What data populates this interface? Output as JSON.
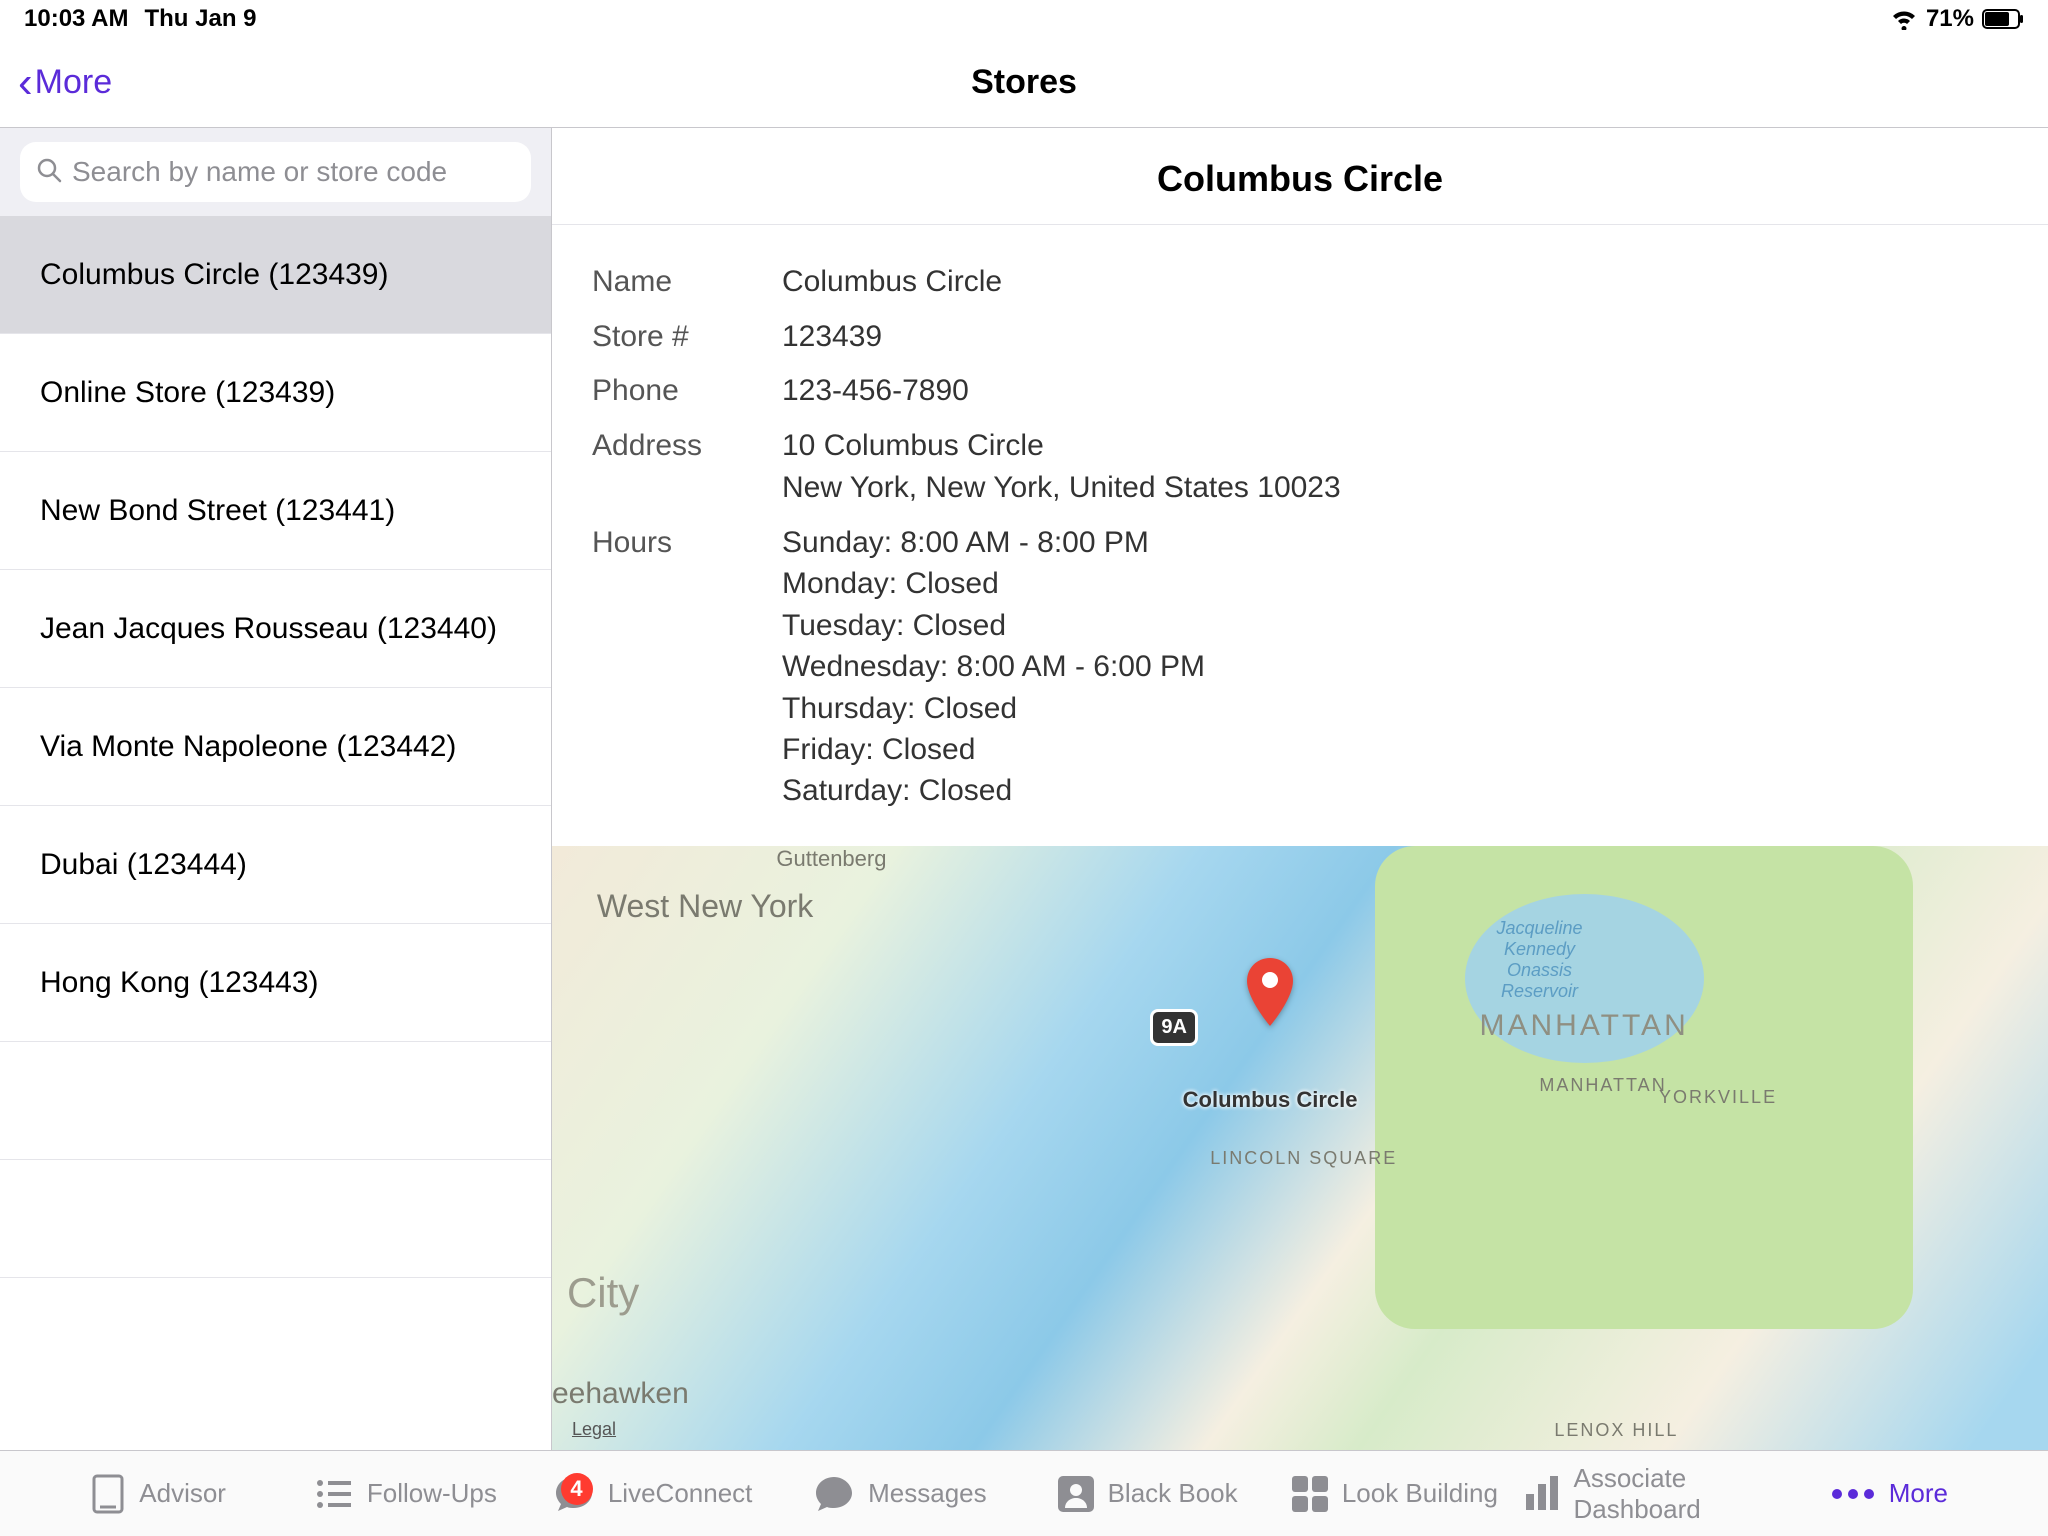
{
  "status": {
    "time": "10:03 AM",
    "date": "Thu Jan 9",
    "battery": "71%"
  },
  "nav": {
    "back_label": "More",
    "title": "Stores"
  },
  "search": {
    "placeholder": "Search by name or store code"
  },
  "stores": [
    {
      "label": "Columbus Circle (123439)",
      "selected": true
    },
    {
      "label": "Online Store (123439)",
      "selected": false
    },
    {
      "label": "New Bond Street (123441)",
      "selected": false
    },
    {
      "label": "Jean Jacques Rousseau (123440)",
      "selected": false
    },
    {
      "label": "Via Monte Napoleone (123442)",
      "selected": false
    },
    {
      "label": "Dubai (123444)",
      "selected": false
    },
    {
      "label": "Hong Kong (123443)",
      "selected": false
    }
  ],
  "detail": {
    "title": "Columbus Circle",
    "name_label": "Name",
    "name_value": "Columbus Circle",
    "store_label": "Store #",
    "store_value": "123439",
    "phone_label": "Phone",
    "phone_value": "123-456-7890",
    "address_label": "Address",
    "address_line1": "10 Columbus Circle",
    "address_line2": "New York, New York, United States 10023",
    "hours_label": "Hours",
    "hours": [
      "Sunday: 8:00 AM - 8:00 PM",
      "Monday: Closed",
      "Tuesday: Closed",
      "Wednesday: 8:00 AM - 6:00 PM",
      "Thursday: Closed",
      "Friday: Closed",
      "Saturday: Closed"
    ]
  },
  "map": {
    "pin_label": "Columbus Circle",
    "road_badge": "9A",
    "legal": "Legal",
    "labels": {
      "west_ny": "West New York",
      "city": "City",
      "eehawken": "eehawken",
      "guttenberg": "Guttenberg",
      "manhattan_big": "MANHATTAN",
      "manhattan_sm": "MANHATTAN",
      "yorkville": "YORKVILLE",
      "lincoln": "LINCOLN SQUARE",
      "lenox": "LENOX HILL",
      "reservoir": "Jacqueline Kennedy Onassis Reservoir"
    }
  },
  "tabs": {
    "advisor": "Advisor",
    "followups": "Follow-Ups",
    "liveconnect": "LiveConnect",
    "liveconnect_badge": "4",
    "messages": "Messages",
    "blackbook": "Black Book",
    "lookbuilding": "Look Building",
    "dashboard": "Associate Dashboard",
    "more": "More"
  }
}
